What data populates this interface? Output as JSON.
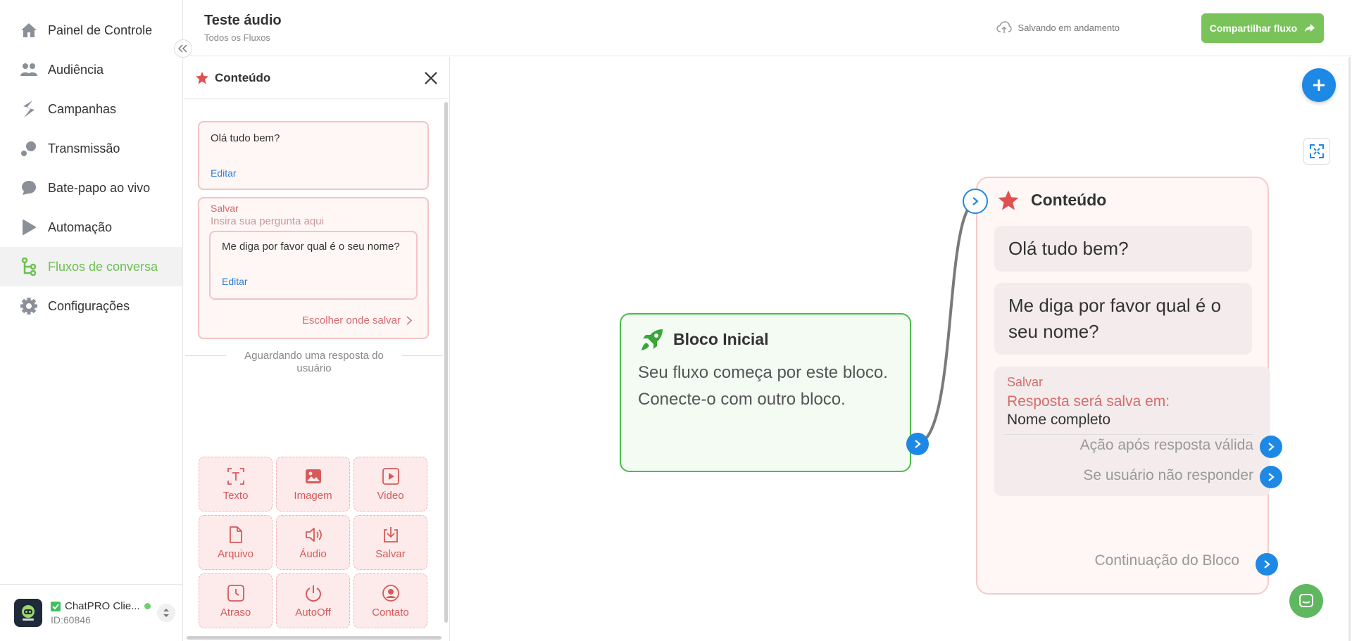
{
  "sidebar": {
    "items": [
      {
        "label": "Painel de Controle",
        "icon": "home-icon"
      },
      {
        "label": "Audiência",
        "icon": "people-icon"
      },
      {
        "label": "Campanhas",
        "icon": "campaign-icon"
      },
      {
        "label": "Transmissão",
        "icon": "broadcast-icon"
      },
      {
        "label": "Bate-papo ao vivo",
        "icon": "chat-bubble-icon"
      },
      {
        "label": "Automação",
        "icon": "play-icon"
      },
      {
        "label": "Fluxos de conversa",
        "icon": "flow-icon",
        "active": true
      },
      {
        "label": "Configurações",
        "icon": "gear-icon"
      }
    ],
    "account": {
      "name": "ChatPRO Clie...",
      "id": "ID:60846"
    }
  },
  "header": {
    "title": "Teste áudio",
    "breadcrumb": "Todos os Fluxos",
    "saving_status": "Salvando em andamento",
    "share_label": "Compartilhar fluxo"
  },
  "panel": {
    "title": "Conteúdo",
    "message1": {
      "text": "Olá tudo bem?",
      "edit": "Editar"
    },
    "save_card": {
      "label": "Salvar",
      "placeholder": "Insira sua pergunta aqui",
      "question": "Me diga por favor qual é o seu nome?",
      "edit": "Editar",
      "choose": "Escolher onde salvar"
    },
    "waiting": "Aguardando uma resposta do usuário",
    "tools": [
      {
        "label": "Texto",
        "icon": "text-icon"
      },
      {
        "label": "Imagem",
        "icon": "image-icon"
      },
      {
        "label": "Video",
        "icon": "video-icon"
      },
      {
        "label": "Arquivo",
        "icon": "file-icon"
      },
      {
        "label": "Áudio",
        "icon": "audio-icon"
      },
      {
        "label": "Salvar",
        "icon": "save-icon"
      },
      {
        "label": "Atraso",
        "icon": "clock-icon"
      },
      {
        "label": "AutoOff",
        "icon": "power-icon"
      },
      {
        "label": "Contato",
        "icon": "contact-icon"
      }
    ]
  },
  "canvas": {
    "start_block": {
      "title": "Bloco Inicial",
      "description": "Seu fluxo começa por este bloco. Conecte-o com outro bloco."
    },
    "content_block": {
      "title": "Conteúdo",
      "message1": "Olá tudo bem?",
      "message2": "Me diga por favor qual é o seu nome?",
      "save_label": "Salvar",
      "save_text": "Resposta será salva em:",
      "save_target": "Nome completo",
      "valid_action": "Ação após resposta válida",
      "no_response": "Se usuário não responder",
      "continuation": "Continuação do Bloco"
    }
  },
  "colors": {
    "accent_green": "#79c35a",
    "primary_blue": "#1e88e5",
    "block_red": "#d56b6b",
    "block_border_green": "#4cbb4c"
  }
}
